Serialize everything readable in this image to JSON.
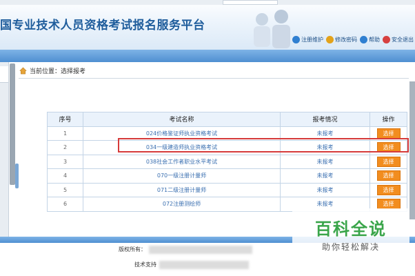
{
  "header": {
    "title": "国专业技术人员资格考试报名服务平台",
    "links": [
      {
        "label": "注册维护",
        "icon": "register-icon",
        "color": "#2f7fd1"
      },
      {
        "label": "修改密码",
        "icon": "password-lock-icon",
        "color": "#e3a21a"
      },
      {
        "label": "帮助",
        "icon": "help-icon",
        "color": "#2f7fd1"
      },
      {
        "label": "安全退出",
        "icon": "logout-icon",
        "color": "#d64040"
      }
    ]
  },
  "breadcrumb": {
    "prefix": "当前位置：",
    "current": "选择报考"
  },
  "table": {
    "headers": [
      "序号",
      "考试名称",
      "报考情况",
      "操作"
    ],
    "rows": [
      {
        "num": "1",
        "name": "024价格鉴证师执业资格考试",
        "status": "未报考",
        "action": "选择"
      },
      {
        "num": "2",
        "name": "034一级建造师执业资格考试",
        "status": "未报考",
        "action": "选择"
      },
      {
        "num": "3",
        "name": "038社会工作者职业水平考试",
        "status": "未报考",
        "action": "选择"
      },
      {
        "num": "4",
        "name": "070一级注册计量师",
        "status": "未报考",
        "action": "选择"
      },
      {
        "num": "5",
        "name": "071二级注册计量师",
        "status": "未报考",
        "action": "选择"
      },
      {
        "num": "6",
        "name": "072注册测绘师",
        "status": "未报考",
        "action": "选择"
      }
    ]
  },
  "footer": {
    "copyright_label": "版权所有：",
    "tech_label": "技术支持"
  },
  "watermark": {
    "title": "百科全说",
    "subtitle": "助你轻松解决"
  },
  "colors": {
    "accent": "#f28d1f",
    "highlight": "#d63a3a",
    "brand": "#1f5d9c"
  }
}
